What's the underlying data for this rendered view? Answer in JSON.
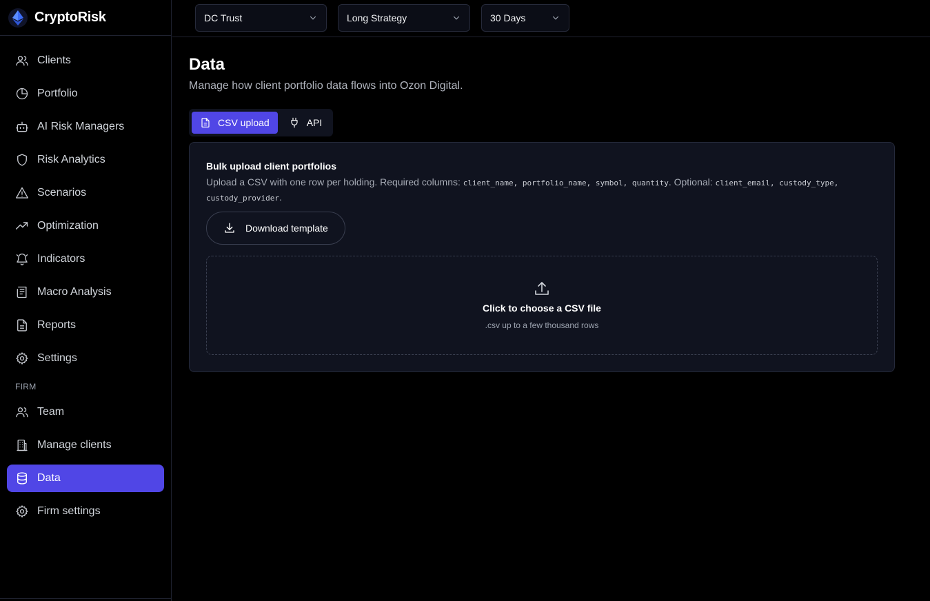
{
  "brand": {
    "name": "CryptoRisk",
    "icon": "ethereum-diamond-icon"
  },
  "sidebar": {
    "items": [
      {
        "label": "Clients",
        "icon": "users-icon"
      },
      {
        "label": "Portfolio",
        "icon": "pie-chart-icon"
      },
      {
        "label": "AI Risk Managers",
        "icon": "bot-icon"
      },
      {
        "label": "Risk Analytics",
        "icon": "shield-icon"
      },
      {
        "label": "Scenarios",
        "icon": "warning-triangle-icon"
      },
      {
        "label": "Optimization",
        "icon": "trending-up-icon"
      },
      {
        "label": "Indicators",
        "icon": "bell-icon"
      },
      {
        "label": "Macro Analysis",
        "icon": "newspaper-icon"
      },
      {
        "label": "Reports",
        "icon": "file-text-icon"
      },
      {
        "label": "Settings",
        "icon": "gear-icon"
      }
    ],
    "firm_label": "FIRM",
    "firm_items": [
      {
        "label": "Team",
        "icon": "users-icon"
      },
      {
        "label": "Manage clients",
        "icon": "building-icon"
      },
      {
        "label": "Data",
        "icon": "database-icon",
        "active": true
      },
      {
        "label": "Firm settings",
        "icon": "gear-icon"
      }
    ]
  },
  "topbar": {
    "client_select": "DC Trust",
    "strategy_select": "Long Strategy",
    "period_select": "30 Days"
  },
  "page": {
    "title": "Data",
    "subtitle": "Manage how client portfolio data flows into Ozon Digital."
  },
  "tabs": [
    {
      "label": "CSV upload",
      "icon": "file-icon",
      "active": true
    },
    {
      "label": "API",
      "icon": "plug-icon",
      "active": false
    }
  ],
  "card": {
    "title": "Bulk upload client portfolios",
    "desc_prefix": "Upload a CSV with one row per holding. Required columns:",
    "required_cols": [
      "client_name",
      "portfolio_name",
      "symbol",
      "quantity"
    ],
    "optional_label": "Optional:",
    "optional_cols": [
      "client_email",
      "custody_type",
      "custody_provider"
    ],
    "download_label": "Download template",
    "dropzone_title": "Click to choose a CSV file",
    "dropzone_hint": ".csv up to a few thousand rows"
  },
  "colors": {
    "accent": "#5046e6",
    "background": "#000000",
    "card": "#10131f"
  }
}
